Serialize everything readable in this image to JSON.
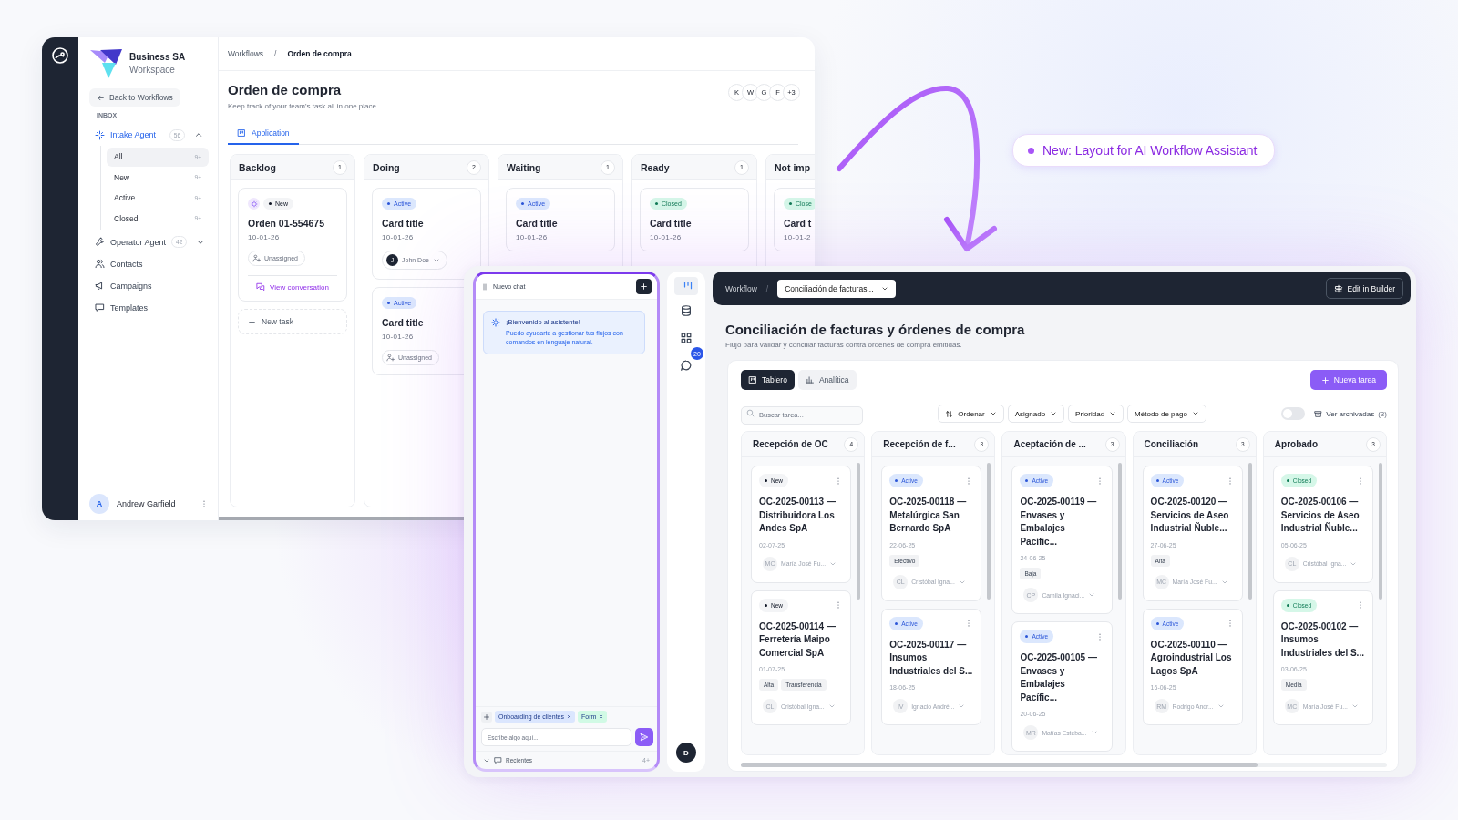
{
  "back_window": {
    "workspace": {
      "name": "Business SA",
      "subtitle": "Workspace"
    },
    "back_link": "Back to Workflows",
    "section_label": "INBOX",
    "nav": [
      {
        "label": "Intake Agent",
        "count": "56",
        "selected": true,
        "expanded": true,
        "children": [
          {
            "label": "All",
            "count": "9+",
            "selected": true
          },
          {
            "label": "New",
            "count": "9+",
            "selected": false
          },
          {
            "label": "Active",
            "count": "9+",
            "selected": false
          },
          {
            "label": "Closed",
            "count": "9+",
            "selected": false
          }
        ]
      },
      {
        "label": "Operator Agent",
        "count": "42",
        "selected": false,
        "expanded": false
      },
      {
        "label": "Contacts",
        "selected": false
      },
      {
        "label": "Campaigns",
        "selected": false
      },
      {
        "label": "Templates",
        "selected": false
      }
    ],
    "user": {
      "initial": "A",
      "name": "Andrew Garfield"
    },
    "breadcrumb": {
      "parent": "Workflows",
      "separator": "/",
      "current": "Orden de compra"
    },
    "title": "Orden de compra",
    "subtitle": "Keep track of your team's task all in one place.",
    "avatars": [
      "K",
      "W",
      "G",
      "F",
      "+3"
    ],
    "tabs": [
      {
        "label": "Application",
        "selected": true
      }
    ],
    "columns": [
      {
        "title": "Backlog",
        "count": "1",
        "add_label": "New task",
        "cards": [
          {
            "ai": true,
            "status": {
              "label": "New",
              "kind": "new"
            },
            "title": "Orden 01-554675",
            "date": "10-01-26",
            "assignee": {
              "name": "Unassigned"
            },
            "link": "View conversation"
          }
        ]
      },
      {
        "title": "Doing",
        "count": "2",
        "cards": [
          {
            "ai": false,
            "status": {
              "label": "Active",
              "kind": "active"
            },
            "title": "Card title",
            "date": "10-01-26",
            "assignee": {
              "name": "John Doe",
              "initial": "J"
            }
          },
          {
            "ai": false,
            "status": {
              "label": "Active",
              "kind": "active"
            },
            "title": "Card title",
            "date": "10-01-26",
            "assignee": {
              "name": "Unassigned"
            }
          }
        ]
      },
      {
        "title": "Waiting",
        "count": "1",
        "cards": [
          {
            "ai": false,
            "status": {
              "label": "Active",
              "kind": "active"
            },
            "title": "Card title",
            "date": "10-01-26"
          }
        ]
      },
      {
        "title": "Ready",
        "count": "1",
        "cards": [
          {
            "ai": false,
            "status": {
              "label": "Closed",
              "kind": "closed"
            },
            "title": "Card title",
            "date": "10-01-26"
          }
        ]
      },
      {
        "title": "Not imp",
        "cards": [
          {
            "ai": false,
            "status": {
              "label": "Close",
              "kind": "closed"
            },
            "title": "Card t",
            "date": "10-01-2"
          }
        ]
      }
    ]
  },
  "callout": {
    "text": "New: Layout for AI Workflow Assistant"
  },
  "front_window": {
    "chat": {
      "title": "Nuevo chat",
      "welcome": {
        "title": "¡Bienvenido al asistente!",
        "body": "Puedo ayudarte a gestionar tus flujos con comandos en lenguaje natural."
      },
      "context_tags": [
        {
          "label": "Onboarding de clientes",
          "color": "#dbe6fe"
        },
        {
          "label": "Form",
          "color": "#d1fae5"
        }
      ],
      "input": {
        "placeholder": "Escribe algo aquí..."
      },
      "recents": {
        "label": "Recientes",
        "count": "4+"
      }
    },
    "rail": {
      "items": [
        {
          "selected": true
        },
        {
          "selected": false
        },
        {
          "selected": false
        },
        {
          "selected": false,
          "badge": "20"
        }
      ],
      "user_initial": "D"
    },
    "header": {
      "breadcrumb": "Workflow",
      "separator": "/",
      "workflow_select": "Conciliación de facturas...",
      "action": "Edit in Builder"
    },
    "title": "Conciliación de facturas y órdenes de compra",
    "subtitle": "Flujo para validar y conciliar facturas contra órdenes de compra emitidas.",
    "view_tabs": [
      {
        "label": "Tablero",
        "selected": true
      },
      {
        "label": "Analítica",
        "selected": false
      }
    ],
    "new_button": "Nueva tarea",
    "search": {
      "placeholder": "Buscar tarea..."
    },
    "filters": [
      "Ordenar",
      "Asignado",
      "Prioridad",
      "Método de pago"
    ],
    "archived": {
      "on": false,
      "label": "Ver archivadas",
      "count": "(3)"
    },
    "columns": [
      {
        "title": "Recepción de OC",
        "count": "4",
        "cards": [
          {
            "status": {
              "label": "New",
              "kind": "new"
            },
            "title": "OC-2025-00113 — Distribuidora Los Andes SpA",
            "date": "02-07-25",
            "assignee": {
              "initials": "MC",
              "name": "María José Fu..."
            }
          },
          {
            "status": {
              "label": "New",
              "kind": "new"
            },
            "title": "OC-2025-00114 — Ferretería Maipo Comercial SpA",
            "date": "01-07-25",
            "tags": [
              "Alta",
              "Transferencia"
            ],
            "assignee": {
              "initials": "CL",
              "name": "Cristóbal Igna..."
            }
          }
        ]
      },
      {
        "title": "Recepción de f...",
        "count": "3",
        "cards": [
          {
            "status": {
              "label": "Active",
              "kind": "active"
            },
            "title": "OC-2025-00118 — Metalúrgica San Bernardo SpA",
            "date": "22-06-25",
            "tags": [
              "Efectivo"
            ],
            "assignee": {
              "initials": "CL",
              "name": "Cristóbal Igna..."
            }
          },
          {
            "status": {
              "label": "Active",
              "kind": "active"
            },
            "title": "OC-2025-00117 — Insumos Industriales del S...",
            "date": "18-06-25",
            "assignee": {
              "initials": "IV",
              "name": "Ignacio André..."
            }
          }
        ]
      },
      {
        "title": "Aceptación de ...",
        "count": "3",
        "cards": [
          {
            "status": {
              "label": "Active",
              "kind": "active"
            },
            "title": "OC-2025-00119 — Envases y Embalajes Pacífic...",
            "date": "24-06-25",
            "tags": [
              "Baja"
            ],
            "assignee": {
              "initials": "CP",
              "name": "Camila Ignaci..."
            }
          },
          {
            "status": {
              "label": "Active",
              "kind": "active"
            },
            "title": "OC-2025-00105 — Envases y Embalajes Pacífic...",
            "date": "20-06-25",
            "assignee": {
              "initials": "MR",
              "name": "Matías Esteba..."
            }
          }
        ]
      },
      {
        "title": "Conciliación",
        "count": "3",
        "cards": [
          {
            "status": {
              "label": "Active",
              "kind": "active"
            },
            "title": "OC-2025-00120 — Servicios de Aseo Industrial Ñuble...",
            "date": "27-06-25",
            "tags": [
              "Alta"
            ],
            "assignee": {
              "initials": "MC",
              "name": "María José Fu..."
            }
          },
          {
            "status": {
              "label": "Active",
              "kind": "active"
            },
            "title": "OC-2025-00110 — Agroindustrial Los Lagos SpA",
            "date": "16-06-25",
            "assignee": {
              "initials": "RM",
              "name": "Rodrigo Andr..."
            }
          }
        ]
      },
      {
        "title": "Aprobado",
        "count": "3",
        "cards": [
          {
            "status": {
              "label": "Closed",
              "kind": "closed"
            },
            "title": "OC-2025-00106 — Servicios de Aseo Industrial Ñuble...",
            "date": "05-06-25",
            "assignee": {
              "initials": "CL",
              "name": "Cristóbal Igna..."
            }
          },
          {
            "status": {
              "label": "Closed",
              "kind": "closed"
            },
            "title": "OC-2025-00102 — Insumos Industriales del S...",
            "date": "03-06-25",
            "tags": [
              "Media"
            ],
            "assignee": {
              "initials": "MC",
              "name": "María José Fu..."
            }
          }
        ]
      }
    ]
  }
}
